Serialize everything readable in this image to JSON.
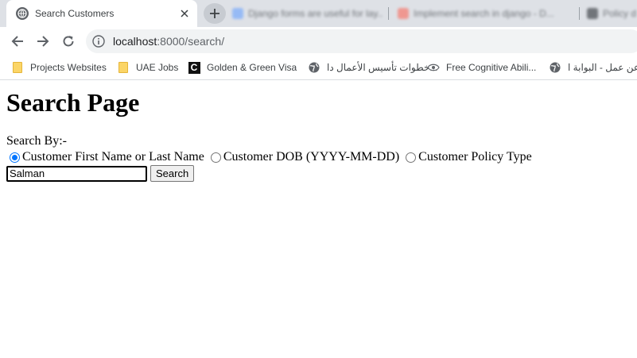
{
  "tabs": {
    "active_title": "Search Customers",
    "background_titles": [
      "Django forms are useful for lay...",
      "Implement search in django - D...",
      "Policy d..."
    ],
    "new_tab_icon": "plus-icon",
    "close_icon": "close-icon"
  },
  "toolbar": {
    "url_host": "localhost",
    "url_rest": ":8000/search/"
  },
  "bookmarks": [
    {
      "label": "Projects Websites",
      "icon": "folder-icon"
    },
    {
      "label": "UAE Jobs",
      "icon": "folder-icon"
    },
    {
      "label": "Golden & Green Visa",
      "icon": "c-logo-icon"
    },
    {
      "label": "خطوات تأسيس الأعمال دا...",
      "icon": "globe-icon"
    },
    {
      "label": "Free Cognitive Abili...",
      "icon": "eye-icon"
    },
    {
      "label": "عن عمل - البوابة ا...",
      "icon": "globe-icon"
    }
  ],
  "page": {
    "heading": "Search Page",
    "search_by_label": "Search By:-",
    "options": [
      {
        "label": "Customer First Name or Last Name",
        "checked": true
      },
      {
        "label": "Customer DOB (YYYY-MM-DD)",
        "checked": false
      },
      {
        "label": "Customer Policy Type",
        "checked": false
      }
    ],
    "search_value": "Salman",
    "search_button": "Search"
  },
  "colors": {
    "tabstrip_bg": "#dee1e6",
    "omnibox_bg": "#f1f3f4",
    "radio_accent": "#0075ff"
  }
}
